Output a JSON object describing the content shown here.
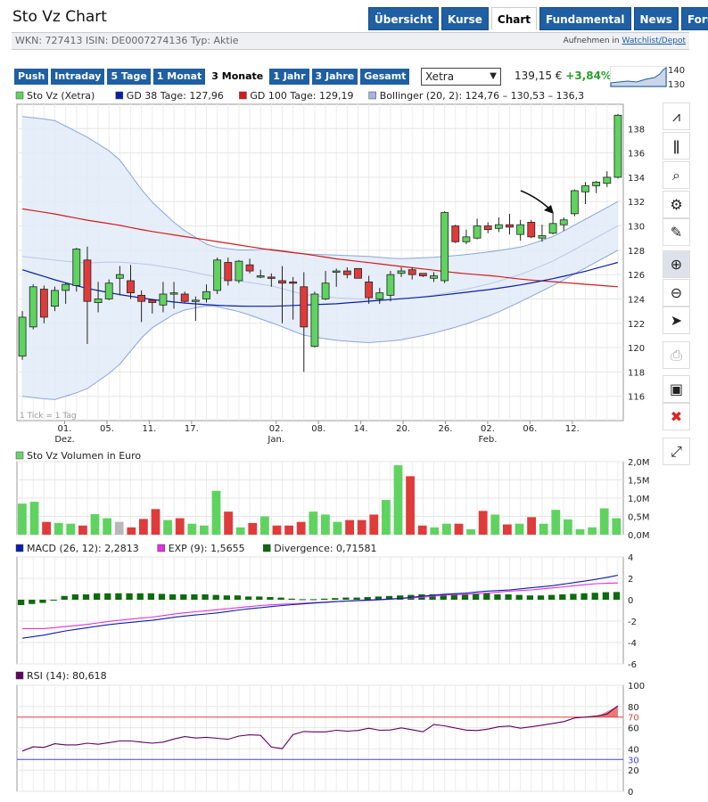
{
  "title": "Sto Vz Chart",
  "nav_tabs": [
    {
      "label": "Übersicht",
      "active": false
    },
    {
      "label": "Kurse",
      "active": false
    },
    {
      "label": "Chart",
      "active": true
    },
    {
      "label": "Fundamental",
      "active": false
    },
    {
      "label": "News",
      "active": false
    },
    {
      "label": "Forum",
      "active": false
    }
  ],
  "info": {
    "line": "WKN: 727413   ISIN: DE0007274136   Typ: Aktie",
    "watch_prefix": "Aufnehmen in",
    "watch_link": "Watchlist/Depot"
  },
  "ranges": [
    {
      "label": "Push",
      "active": false
    },
    {
      "label": "Intraday",
      "active": false
    },
    {
      "label": "5 Tage",
      "active": false
    },
    {
      "label": "1 Monat",
      "active": false
    },
    {
      "label": "3 Monate",
      "active": true
    },
    {
      "label": "1 Jahr",
      "active": false
    },
    {
      "label": "3 Jahre",
      "active": false
    },
    {
      "label": "Gesamt",
      "active": false
    }
  ],
  "exchange": {
    "selected": "Xetra"
  },
  "quote": {
    "price": "139,15 €",
    "change": "+3,84%"
  },
  "mini_chart": {
    "labels": [
      "140",
      "130"
    ]
  },
  "toolbar_icons": [
    "line-chart-icon",
    "ohlc-chart-icon",
    "indicator-icon",
    "settings-gear-icon",
    "draw-line-icon",
    "zoom-in-icon",
    "zoom-out-icon",
    "pointer-icon",
    "print-icon",
    "save-icon",
    "delete-icon",
    "fullscreen-icon"
  ],
  "colors": {
    "up": "#5fd35f",
    "down": "#e03b3b",
    "neutral": "#b8b8b8",
    "gd38": "#0a1fa8",
    "gd100": "#d41a1a",
    "bollinger_fill": "#e2ebf8",
    "bollinger_line": "#8aa6d6",
    "volume": "#6cd36c",
    "macd": "#0a1fa8",
    "exp": "#e030e0",
    "divergence": "#0d6b0d",
    "rsi": "#600060",
    "rsi_70": "#e04040",
    "rsi_30": "#4040e0"
  },
  "chart_data": [
    {
      "type": "candlestick",
      "legend": [
        {
          "label": "Sto Vz (Xetra)",
          "color": "#5fd35f"
        },
        {
          "label": "GD 38 Tage: 127,96",
          "color": "#0a1fa8"
        },
        {
          "label": "GD 100 Tage: 129,19",
          "color": "#d41a1a"
        },
        {
          "label": "Bollinger (20, 2): 124,76 – 130,53 – 136,3",
          "color": "#9fb6e0"
        }
      ],
      "tick_note": "1 Tick = 1 Tag",
      "ylim": [
        114,
        140
      ],
      "yticks": [
        116,
        118,
        120,
        122,
        124,
        126,
        128,
        130,
        132,
        134,
        136,
        138
      ],
      "x_ticks": [
        {
          "i": 3,
          "label": "01.",
          "sub": "Dez."
        },
        {
          "i": 6,
          "label": "05.",
          "sub": ""
        },
        {
          "i": 9,
          "label": "11.",
          "sub": ""
        },
        {
          "i": 12,
          "label": "17.",
          "sub": ""
        },
        {
          "i": 18,
          "label": "02.",
          "sub": "Jan."
        },
        {
          "i": 21,
          "label": "08.",
          "sub": ""
        },
        {
          "i": 24,
          "label": "14.",
          "sub": ""
        },
        {
          "i": 27,
          "label": "20.",
          "sub": ""
        },
        {
          "i": 30,
          "label": "26.",
          "sub": ""
        },
        {
          "i": 33,
          "label": "02.",
          "sub": "Feb."
        },
        {
          "i": 36,
          "label": "06.",
          "sub": ""
        },
        {
          "i": 39,
          "label": "12.",
          "sub": ""
        }
      ],
      "candles": [
        {
          "o": 119.3,
          "h": 123.0,
          "l": 119.0,
          "c": 122.5
        },
        {
          "o": 121.7,
          "h": 125.2,
          "l": 121.5,
          "c": 125.0
        },
        {
          "o": 124.8,
          "h": 125.1,
          "l": 122.0,
          "c": 122.5
        },
        {
          "o": 123.4,
          "h": 125.0,
          "l": 123.0,
          "c": 124.7
        },
        {
          "o": 124.7,
          "h": 125.3,
          "l": 123.6,
          "c": 125.2
        },
        {
          "o": 125.1,
          "h": 128.2,
          "l": 124.6,
          "c": 128.1
        },
        {
          "o": 127.2,
          "h": 128.3,
          "l": 120.3,
          "c": 123.8
        },
        {
          "o": 123.7,
          "h": 125.4,
          "l": 122.9,
          "c": 124.0
        },
        {
          "o": 124.0,
          "h": 125.6,
          "l": 123.9,
          "c": 125.3
        },
        {
          "o": 125.7,
          "h": 126.7,
          "l": 124.3,
          "c": 126.0
        },
        {
          "o": 125.5,
          "h": 126.8,
          "l": 124.0,
          "c": 124.5
        },
        {
          "o": 124.3,
          "h": 124.7,
          "l": 122.1,
          "c": 123.8
        },
        {
          "o": 123.9,
          "h": 124.0,
          "l": 122.8,
          "c": 123.7
        },
        {
          "o": 123.5,
          "h": 125.4,
          "l": 122.9,
          "c": 124.4
        },
        {
          "o": 124.5,
          "h": 125.4,
          "l": 123.2,
          "c": 124.5
        },
        {
          "o": 124.4,
          "h": 124.6,
          "l": 123.7,
          "c": 123.8
        },
        {
          "o": 123.8,
          "h": 124.2,
          "l": 122.2,
          "c": 123.9
        },
        {
          "o": 124.0,
          "h": 125.2,
          "l": 123.7,
          "c": 124.6
        },
        {
          "o": 124.7,
          "h": 127.4,
          "l": 124.4,
          "c": 127.2
        },
        {
          "o": 127.0,
          "h": 127.4,
          "l": 125.1,
          "c": 125.5
        },
        {
          "o": 125.5,
          "h": 127.2,
          "l": 125.3,
          "c": 127.1
        },
        {
          "o": 126.8,
          "h": 127.3,
          "l": 126.1,
          "c": 126.3
        },
        {
          "o": 125.9,
          "h": 126.4,
          "l": 125.7,
          "c": 125.9
        },
        {
          "o": 125.8,
          "h": 126.1,
          "l": 125.0,
          "c": 125.7
        },
        {
          "o": 125.5,
          "h": 126.7,
          "l": 122.0,
          "c": 125.3
        },
        {
          "o": 125.4,
          "h": 125.8,
          "l": 122.3,
          "c": 125.3
        },
        {
          "o": 125.0,
          "h": 126.2,
          "l": 118.0,
          "c": 121.7
        },
        {
          "o": 120.1,
          "h": 124.6,
          "l": 120.0,
          "c": 124.4
        },
        {
          "o": 124.0,
          "h": 126.3,
          "l": 123.9,
          "c": 125.3
        },
        {
          "o": 126.3,
          "h": 126.5,
          "l": 125.0,
          "c": 126.3
        },
        {
          "o": 126.3,
          "h": 126.6,
          "l": 125.7,
          "c": 126.0
        },
        {
          "o": 126.5,
          "h": 126.5,
          "l": 125.9,
          "c": 125.7
        },
        {
          "o": 125.4,
          "h": 125.9,
          "l": 123.6,
          "c": 124.1
        },
        {
          "o": 124.0,
          "h": 124.9,
          "l": 123.6,
          "c": 124.5
        },
        {
          "o": 124.3,
          "h": 126.3,
          "l": 123.8,
          "c": 126.0
        },
        {
          "o": 126.1,
          "h": 126.6,
          "l": 125.8,
          "c": 126.3
        },
        {
          "o": 126.4,
          "h": 126.6,
          "l": 125.6,
          "c": 126.0
        },
        {
          "o": 126.1,
          "h": 126.1,
          "l": 125.8,
          "c": 125.9
        },
        {
          "o": 125.7,
          "h": 126.2,
          "l": 125.4,
          "c": 125.9
        },
        {
          "o": 125.5,
          "h": 131.2,
          "l": 125.3,
          "c": 131.1
        },
        {
          "o": 130.0,
          "h": 130.1,
          "l": 128.6,
          "c": 128.7
        },
        {
          "o": 128.7,
          "h": 129.7,
          "l": 128.5,
          "c": 129.1
        },
        {
          "o": 129.0,
          "h": 130.6,
          "l": 128.9,
          "c": 130.0
        },
        {
          "o": 130.0,
          "h": 130.3,
          "l": 129.4,
          "c": 129.7
        },
        {
          "o": 129.8,
          "h": 130.7,
          "l": 129.5,
          "c": 130.1
        },
        {
          "o": 130.1,
          "h": 131.0,
          "l": 129.3,
          "c": 129.9
        },
        {
          "o": 129.3,
          "h": 130.5,
          "l": 128.8,
          "c": 130.1
        },
        {
          "o": 130.3,
          "h": 130.5,
          "l": 129.0,
          "c": 129.1
        },
        {
          "o": 129.0,
          "h": 130.1,
          "l": 128.7,
          "c": 129.2
        },
        {
          "o": 129.4,
          "h": 131.0,
          "l": 129.3,
          "c": 130.2
        },
        {
          "o": 130.1,
          "h": 130.7,
          "l": 129.6,
          "c": 130.5
        },
        {
          "o": 131.0,
          "h": 133.0,
          "l": 130.8,
          "c": 132.9
        },
        {
          "o": 132.8,
          "h": 133.6,
          "l": 131.8,
          "c": 133.3
        },
        {
          "o": 133.3,
          "h": 133.7,
          "l": 132.7,
          "c": 133.6
        },
        {
          "o": 133.5,
          "h": 134.5,
          "l": 133.2,
          "c": 134.0
        },
        {
          "o": 134.0,
          "h": 139.2,
          "l": 133.9,
          "c": 139.1
        }
      ],
      "gd100": [
        131.4,
        131.0,
        130.5,
        130.1,
        129.6,
        129.2,
        128.8,
        128.4,
        128.0,
        127.7,
        127.3,
        127.0,
        126.7,
        126.4,
        126.1,
        125.9,
        125.6,
        125.4,
        125.2,
        125.0
      ],
      "gd38": [
        126.4,
        125.6,
        124.9,
        124.4,
        124.0,
        123.7,
        123.5,
        123.4,
        123.4,
        123.5,
        123.6,
        123.8,
        124.0,
        124.2,
        124.5,
        124.8,
        125.2,
        125.7,
        126.3,
        127.0
      ],
      "boll_upper": [
        139.0,
        138.7,
        137.4,
        135.8,
        132.3,
        129.9,
        128.3,
        128.0,
        128.1,
        127.7,
        127.6,
        127.5,
        127.3,
        127.4,
        127.6,
        127.9,
        128.3,
        129.2,
        130.6,
        132.0
      ],
      "boll_lower": [
        116.0,
        115.7,
        116.5,
        118.3,
        121.4,
        123.0,
        123.5,
        122.9,
        122.0,
        121.0,
        120.6,
        120.4,
        120.6,
        121.1,
        121.8,
        122.7,
        123.9,
        125.2,
        126.6,
        128.0
      ],
      "annotation": "arrow pointing at 09 Feb candle"
    },
    {
      "type": "bar",
      "title": "Sto Vz Volumen in Euro",
      "ylim": [
        0,
        2.0
      ],
      "yticks": [
        "0,0M",
        "0,5M",
        "1,0M",
        "1,5M",
        "2,0M"
      ],
      "values": [
        0.85,
        0.9,
        0.35,
        0.32,
        0.3,
        0.25,
        0.56,
        0.45,
        0.35,
        0.2,
        0.43,
        0.7,
        0.4,
        0.45,
        0.3,
        0.25,
        1.2,
        0.63,
        0.2,
        0.32,
        0.5,
        0.25,
        0.25,
        0.35,
        0.63,
        0.55,
        0.35,
        0.4,
        0.4,
        0.55,
        0.95,
        1.9,
        1.6,
        0.25,
        0.2,
        0.3,
        0.3,
        0.15,
        0.65,
        0.55,
        0.28,
        0.3,
        0.48,
        0.3,
        0.68,
        0.42,
        0.15,
        0.2,
        0.72,
        0.45
      ],
      "gray_bars": [
        8
      ]
    },
    {
      "type": "line+bar",
      "legend": [
        {
          "label": "MACD (26, 12): 2,2813",
          "color": "#0a1fa8"
        },
        {
          "label": "EXP (9): 1,5655",
          "color": "#e030e0"
        },
        {
          "label": "Divergence: 0,71581",
          "color": "#0d6b0d"
        }
      ],
      "ylim": [
        -6,
        4
      ],
      "yticks": [
        -6,
        -4,
        -2,
        0,
        2,
        4
      ],
      "macd": [
        -3.6,
        -3.3,
        -2.9,
        -2.6,
        -2.3,
        -2.1,
        -1.9,
        -1.6,
        -1.4,
        -1.2,
        -0.9,
        -0.7,
        -0.5,
        -0.35,
        -0.2,
        -0.1,
        0.0,
        0.1,
        0.3,
        0.5,
        0.6,
        0.8,
        0.9,
        1.1,
        1.3,
        1.6,
        1.9,
        2.28
      ],
      "exp": [
        -2.7,
        -2.7,
        -2.5,
        -2.3,
        -2.0,
        -1.8,
        -1.6,
        -1.3,
        -1.1,
        -0.9,
        -0.7,
        -0.5,
        -0.4,
        -0.3,
        -0.2,
        -0.1,
        -0.05,
        0.1,
        0.2,
        0.4,
        0.5,
        0.6,
        0.8,
        0.9,
        1.1,
        1.3,
        1.5,
        1.57
      ],
      "divergence": [
        -0.5,
        -0.4,
        -0.3,
        -0.05,
        0.35,
        0.5,
        0.5,
        0.6,
        0.6,
        0.6,
        0.6,
        0.6,
        0.6,
        0.55,
        0.5,
        0.5,
        0.5,
        0.5,
        0.45,
        0.4,
        0.4,
        0.3,
        0.3,
        0.25,
        0.2,
        0.1,
        0.05,
        0.05,
        0.1,
        0.15,
        0.2,
        0.2,
        0.25,
        0.3,
        0.35,
        0.4,
        0.45,
        0.5,
        0.5,
        0.5,
        0.55,
        0.55,
        0.6,
        0.6,
        0.5,
        0.5,
        0.45,
        0.4,
        0.4,
        0.45,
        0.5,
        0.55,
        0.6,
        0.65,
        0.7,
        0.72
      ]
    },
    {
      "type": "line",
      "legend": [
        {
          "label": "RSI (14): 80,618",
          "color": "#600060"
        }
      ],
      "ylim": [
        0,
        100
      ],
      "yticks": [
        0,
        20,
        30,
        40,
        60,
        70,
        80,
        100
      ],
      "rsi": [
        38,
        42,
        41,
        45,
        44,
        43,
        46,
        44,
        45,
        47,
        48,
        47,
        46,
        45,
        47,
        50,
        52,
        50,
        51,
        50,
        49,
        52,
        53,
        55,
        44,
        35,
        52,
        56,
        57,
        55,
        57,
        58,
        56,
        58,
        60,
        57,
        58,
        60,
        58,
        56,
        63,
        62,
        60,
        58,
        57,
        58,
        60,
        62,
        61,
        58,
        63,
        62,
        65,
        66,
        70,
        70,
        71,
        73,
        80.6
      ]
    }
  ]
}
